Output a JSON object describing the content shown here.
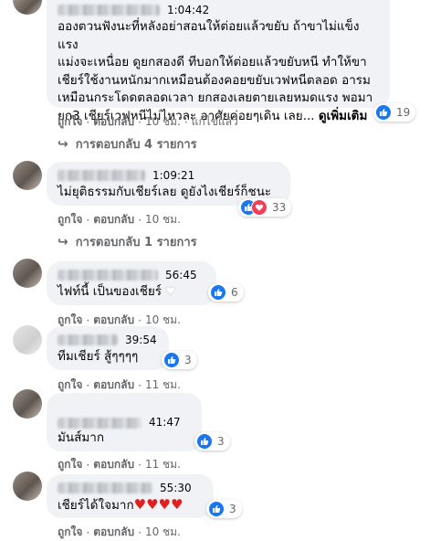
{
  "comments": [
    {
      "timestamp": "1:04:42",
      "text": "อองตวนฟังนะที่หลังอย่าสอนให้ต่อยแล้วขยับ ถ้าขาไม่แข็งแรง\nแม่งจะเหนื่อย ดูยกสองดี ทีบอกให้ต่อยแล้วขยับหนี ทำให้ขา\nเชียร์ใช้งานหนักมากเหมือนต้องคอยขยับเวฟหนีตลอด อารม\nเหมือนกระโดดตลอดเวลา ยกสองเลยตายเลยหมดแรง พอมา\nยก3 เชียร์เวฟหนีไม่ไหวละ อาศัยค่อยๆเดิน เลย... ",
      "see_more": "ดูเพิ่มเติม",
      "reaction_count": "19",
      "like": "ถูกใจ",
      "reply": "ตอบกลับ",
      "time_ago": "10 ชม.",
      "edited": "แก้ไขแล้ว",
      "replies_label": "การตอบกลับ 4 รายการ"
    },
    {
      "timestamp": "1:09:21",
      "text": "ไม่ยุติธรรมกับเชียร์เลย ดูยังไงเชียร์ก็ชนะ",
      "reaction_count": "33",
      "like": "ถูกใจ",
      "reply": "ตอบกลับ",
      "time_ago": "10 ชม.",
      "replies_label": "การตอบกลับ 1 รายการ"
    },
    {
      "timestamp": "56:45",
      "text": "ไฟท์นี้ เป็นของเชียร์",
      "text_emoji": "♥",
      "reaction_count": "6",
      "like": "ถูกใจ",
      "reply": "ตอบกลับ",
      "time_ago": "10 ชม."
    },
    {
      "timestamp": "39:54",
      "text": "ทีมเชียร์ สู้ๆๆๆๆ",
      "reaction_count": "3",
      "like": "ถูกใจ",
      "reply": "ตอบกลับ",
      "time_ago": "11 ชม."
    },
    {
      "timestamp": "41:47",
      "text": "มันส์มาก",
      "reaction_count": "3",
      "like": "ถูกใจ",
      "reply": "ตอบกลับ",
      "time_ago": "11 ชม."
    },
    {
      "timestamp": "55:30",
      "text": "เชียร์ได้ใจมาก",
      "text_emoji": "♥♥♥♥",
      "reaction_count": "3",
      "like": "ถูกใจ",
      "reply": "ตอบกลับ",
      "time_ago": "10 ชม."
    }
  ],
  "sep": "·",
  "reply_arrow": "↪",
  "colors": {
    "like_blue": "#1877f2",
    "love_red": "#f33e58",
    "bubble": "#f0f2f5",
    "meta": "#65676b"
  },
  "icons": {
    "like": "thumbs-up-icon",
    "love": "heart-icon",
    "reply_arrow": "reply-arrow-icon"
  }
}
